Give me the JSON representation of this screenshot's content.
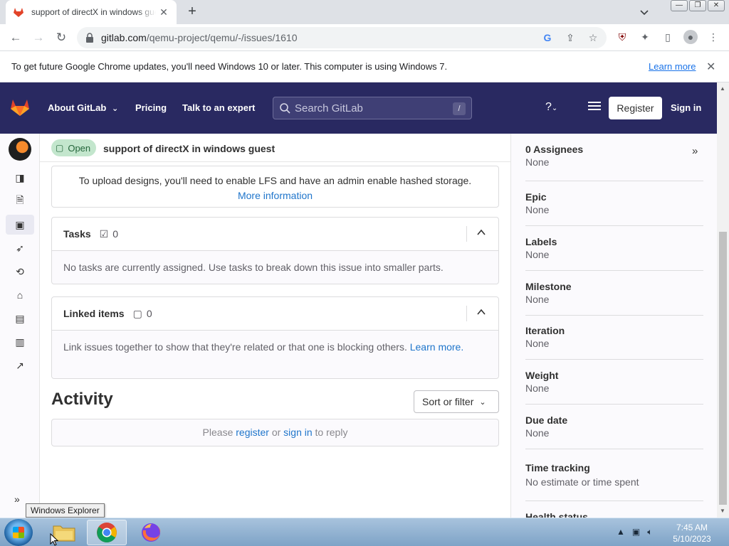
{
  "browser": {
    "tab_title": "support of directX in windows guest",
    "url_host": "gitlab.com",
    "url_path": "/qemu-project/qemu/-/issues/1610",
    "window_controls": [
      "—",
      "❐",
      "✕"
    ]
  },
  "infobar": {
    "message": "To get future Google Chrome updates, you'll need Windows 10 or later. This computer is using Windows 7.",
    "learn_more": "Learn more"
  },
  "gitlab_header": {
    "about": "About GitLab",
    "pricing": "Pricing",
    "talk": "Talk to an expert",
    "search_placeholder": "Search GitLab",
    "search_shortcut": "/",
    "register": "Register",
    "sign_in": "Sign in"
  },
  "issue": {
    "status": "Open",
    "title": "support of directX in windows guest",
    "upload_notice": "To upload designs, you'll need to enable LFS and have an admin enable hashed storage.",
    "more_information": "More information",
    "tasks": {
      "heading": "Tasks",
      "count": "0",
      "empty": "No tasks are currently assigned. Use tasks to break down this issue into smaller parts."
    },
    "linked_items": {
      "heading": "Linked items",
      "count": "0",
      "empty_text": "Link issues together to show that they're related or that one is blocking others.",
      "learn": "Learn",
      "more": "more."
    },
    "activity": {
      "heading": "Activity",
      "sort_label": "Sort or filter",
      "reply_prefix": "Please",
      "register": "register",
      "or": "or",
      "sign_in": "sign in",
      "reply_suffix": "to reply"
    }
  },
  "right_sidebar": {
    "items": [
      {
        "label": "0 Assignees",
        "value": "None"
      },
      {
        "label": "Epic",
        "value": "None"
      },
      {
        "label": "Labels",
        "value": "None"
      },
      {
        "label": "Milestone",
        "value": "None"
      },
      {
        "label": "Iteration",
        "value": "None"
      },
      {
        "label": "Weight",
        "value": "None"
      },
      {
        "label": "Due date",
        "value": "None"
      },
      {
        "label": "Time tracking",
        "value": "No estimate or time spent"
      },
      {
        "label": "Health status",
        "value": ""
      }
    ]
  },
  "taskbar": {
    "tooltip": "Windows Explorer",
    "time": "7:45 AM",
    "date": "5/10/2023"
  },
  "colors": {
    "gitlab_header": "#292961",
    "open_badge_bg": "#c3e6cd",
    "link": "#1f75cb"
  }
}
